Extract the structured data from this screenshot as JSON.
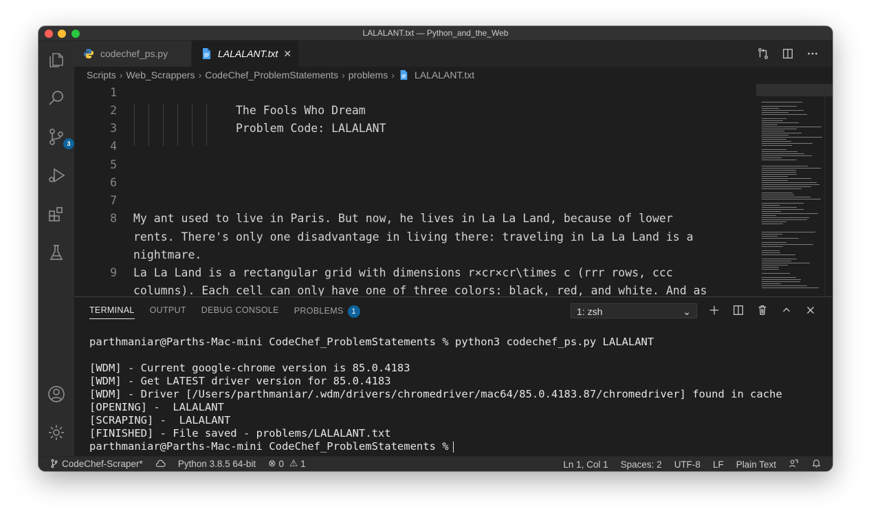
{
  "window": {
    "title": "LALALANT.txt — Python_and_the_Web"
  },
  "activity_bar": {
    "scm_badge": "3"
  },
  "tabs": [
    {
      "label": "codechef_ps.py"
    },
    {
      "label": "LALALANT.txt",
      "close": "✕"
    }
  ],
  "breadcrumb": [
    "Scripts",
    "Web_Scrappers",
    "CodeChef_ProblemStatements",
    "problems",
    "LALALANT.txt"
  ],
  "editor": {
    "line_numbers": [
      "1",
      "2",
      "3",
      "4",
      "5",
      "6",
      "7",
      "8",
      "9"
    ],
    "lines": {
      "l2": "The Fools Who Dream",
      "l3": "Problem Code: LALALANT",
      "l8a": "My ant used to live in Paris. But now, he lives in La La Land, because of lower",
      "l8b": "rents. There's only one disadvantage in living there: traveling in La La Land is a",
      "l8c": "nightmare.",
      "l9a": "La La Land is a rectangular grid with dimensions r×cr×cr\\times c (rrr rows, ccc",
      "l9b": "columns). Each cell can only have one of three colors: black, red, and white. And as"
    }
  },
  "panel": {
    "tabs": [
      "TERMINAL",
      "OUTPUT",
      "DEBUG CONSOLE",
      "PROBLEMS"
    ],
    "problems_badge": "1",
    "terminal_select": "1: zsh",
    "terminal_lines": [
      "parthmaniar@Parths-Mac-mini CodeChef_ProblemStatements % python3 codechef_ps.py LALALANT",
      "",
      "[WDM] - Current google-chrome version is 85.0.4183",
      "[WDM] - Get LATEST driver version for 85.0.4183",
      "[WDM] - Driver [/Users/parthmaniar/.wdm/drivers/chromedriver/mac64/85.0.4183.87/chromedriver] found in cache",
      "[OPENING] -  LALALANT",
      "[SCRAPING] -  LALALANT",
      "[FINISHED] - File saved - problems/LALALANT.txt"
    ],
    "prompt": "parthmaniar@Parths-Mac-mini CodeChef_ProblemStatements %"
  },
  "statusbar": {
    "branch": "CodeChef-Scraper*",
    "python": "Python 3.8.5 64-bit",
    "errors": "0",
    "warnings": "1",
    "position": "Ln 1, Col 1",
    "spaces": "Spaces: 2",
    "encoding": "UTF-8",
    "eol": "LF",
    "language": "Plain Text"
  },
  "colors": {
    "accent": "#0e639c",
    "background": "#1e1e1e",
    "statusbar": "#2c2c2c"
  }
}
